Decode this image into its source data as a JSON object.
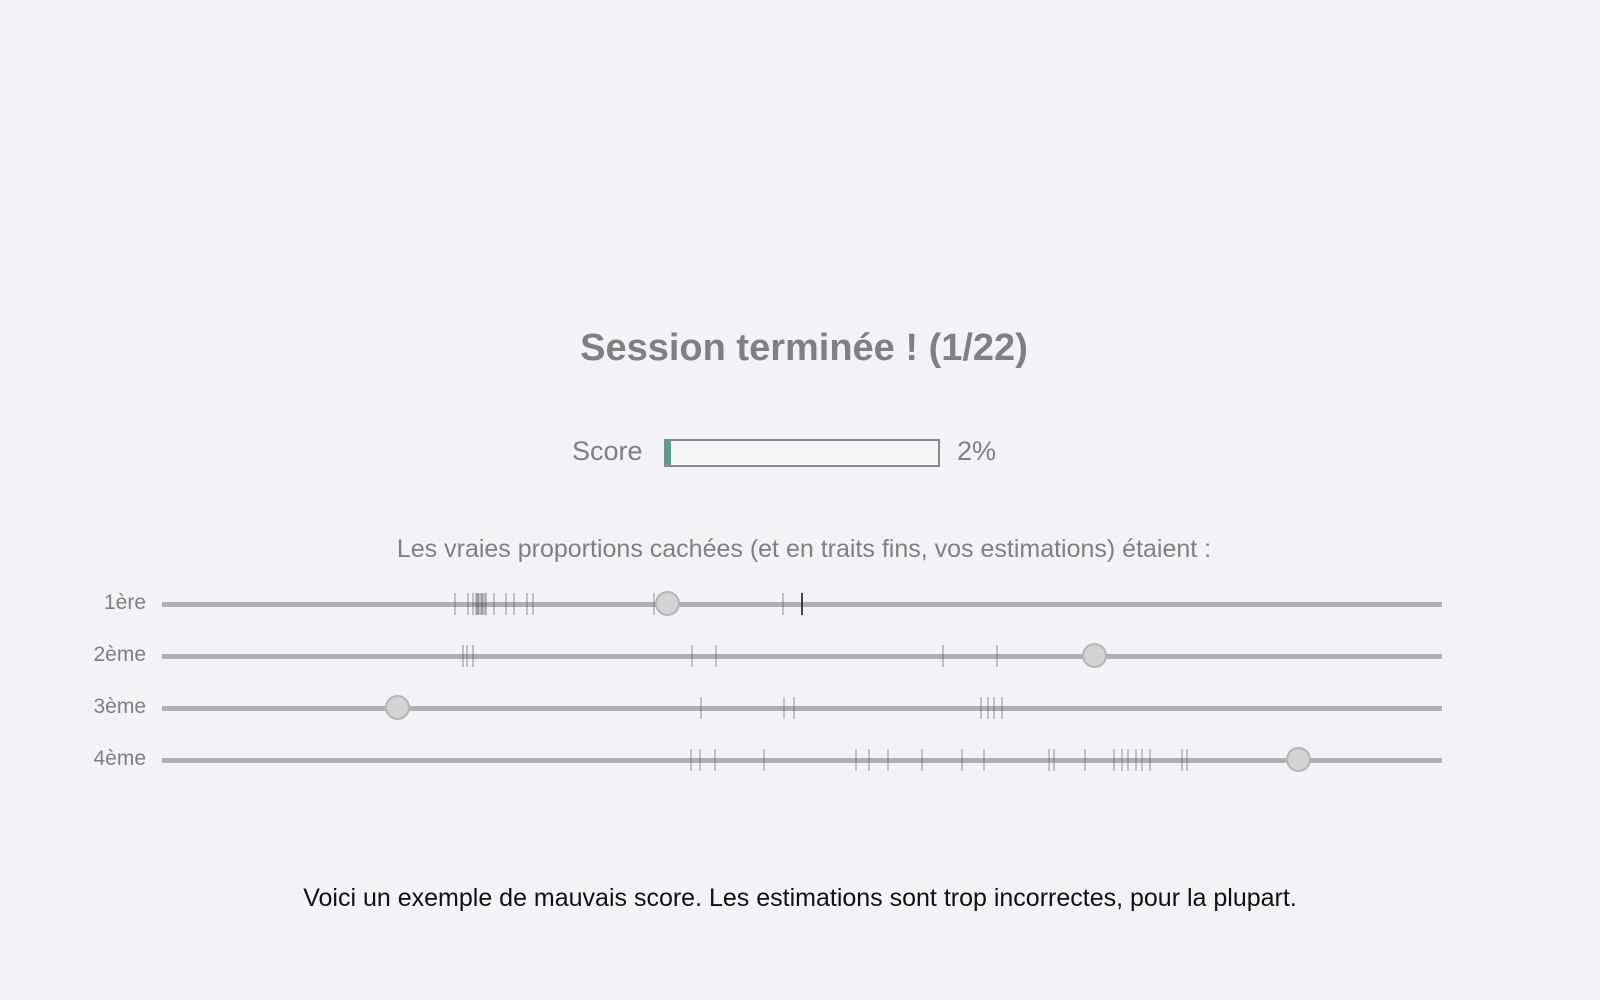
{
  "page": {
    "title": "Session terminée ! (1/22)",
    "score_label": "Score",
    "score_value": "2%",
    "score_fraction": 0.02,
    "subtitle": "Les vraies proportions cachées (et en traits fins, vos estimations) étaient :",
    "footer": "Voici un exemple de mauvais score. Les estimations sont trop incorrectes, pour la plupart."
  },
  "colors": {
    "background": "#f3f2f5",
    "score_fill": "#4ea58d",
    "muted_text": "#808080",
    "track": "#b0b0b0"
  },
  "chart_data": {
    "type": "scatter",
    "xlim": [
      0,
      1
    ],
    "rows": [
      {
        "label": "1ère",
        "true_value": 0.396,
        "estimates": [
          0.229,
          0.239,
          0.243,
          0.245,
          0.246,
          0.247,
          0.248,
          0.249,
          0.25,
          0.251,
          0.252,
          0.253,
          0.259,
          0.269,
          0.275,
          0.285,
          0.29,
          0.384,
          0.485
        ],
        "highlight_estimates": [
          0.5
        ]
      },
      {
        "label": "2ème",
        "true_value": 0.73,
        "estimates": [
          0.235,
          0.238,
          0.243,
          0.414,
          0.433,
          0.61,
          0.652
        ]
      },
      {
        "label": "3ème",
        "true_value": 0.185,
        "estimates": [
          0.421,
          0.486,
          0.494,
          0.64,
          0.645,
          0.65,
          0.656
        ]
      },
      {
        "label": "4ème",
        "true_value": 0.889,
        "estimates": [
          0.413,
          0.42,
          0.432,
          0.47,
          0.542,
          0.552,
          0.567,
          0.594,
          0.625,
          0.642,
          0.693,
          0.697,
          0.721,
          0.744,
          0.75,
          0.755,
          0.761,
          0.766,
          0.772,
          0.797,
          0.801
        ]
      }
    ]
  }
}
